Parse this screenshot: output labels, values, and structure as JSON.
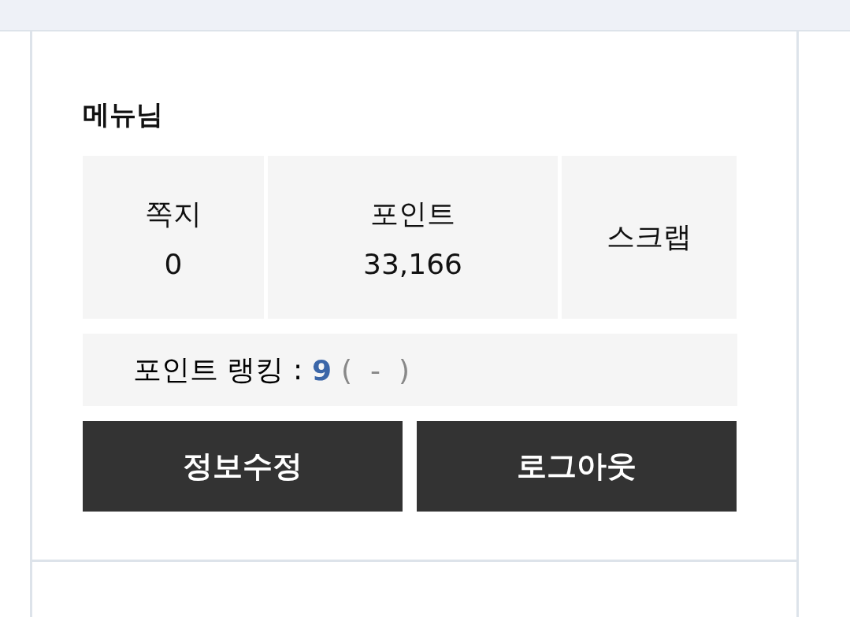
{
  "user": {
    "name": "메뉴님"
  },
  "stats": [
    {
      "kind": "count",
      "label": "쪽지",
      "value": "0"
    },
    {
      "kind": "count",
      "label": "포인트",
      "value": "33,166"
    },
    {
      "kind": "link",
      "label": "스크랩"
    }
  ],
  "ranking": {
    "label": "포인트 랭킹 :",
    "value": "9",
    "change": "( - )"
  },
  "buttons": [
    "정보수정",
    "로그아웃"
  ]
}
